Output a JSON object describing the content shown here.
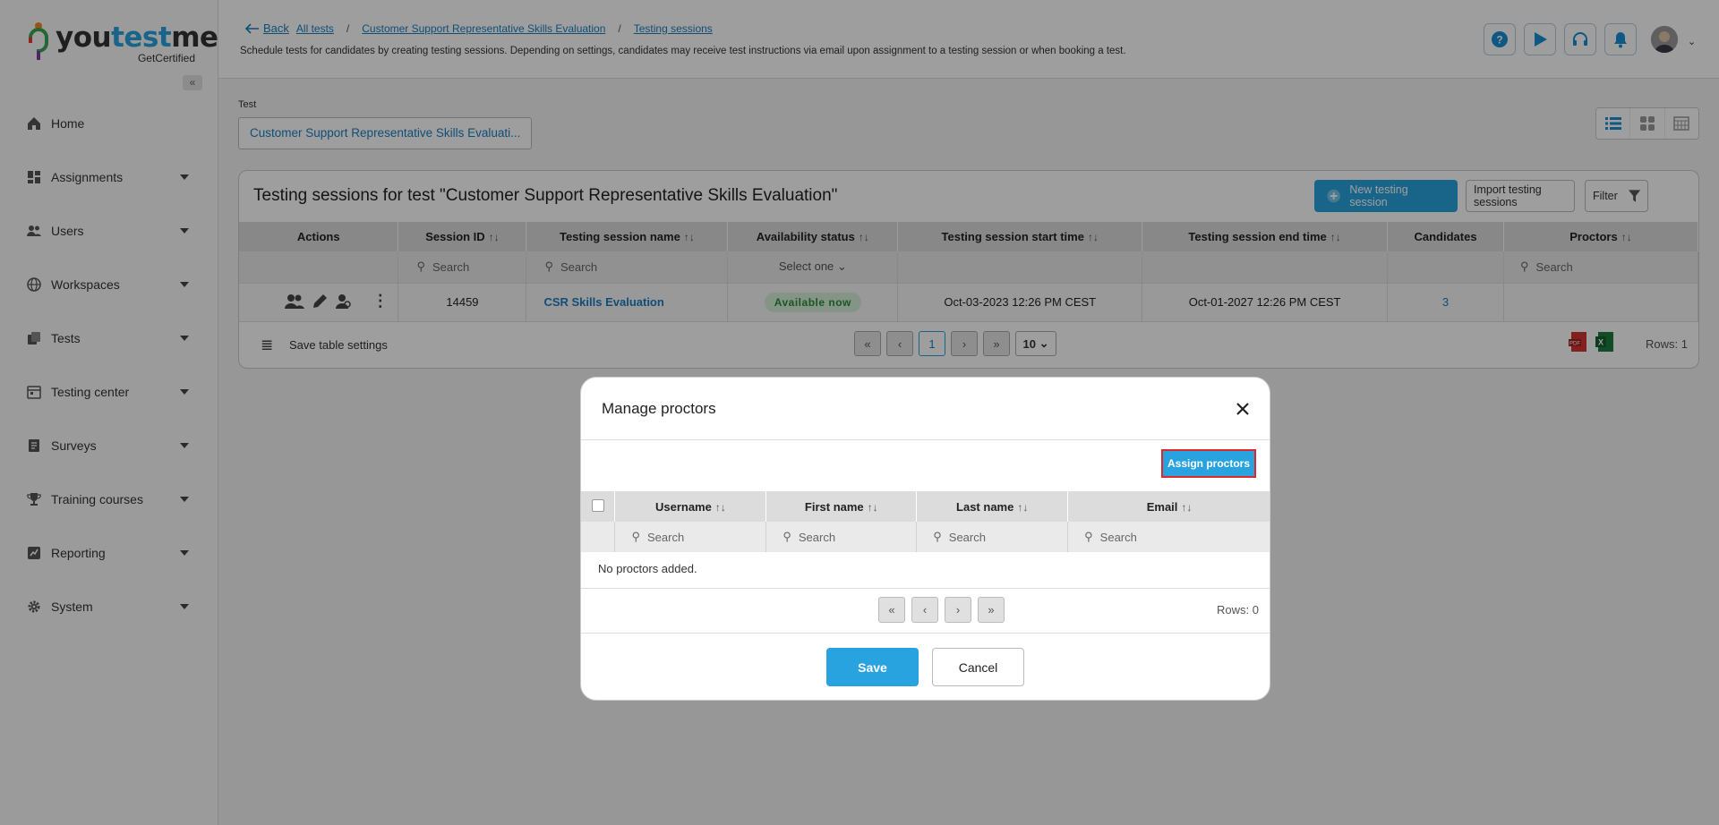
{
  "app": {
    "logo_word_a": "you",
    "logo_word_b": "test",
    "logo_word_c": "me",
    "logo_sub": "GetCertified"
  },
  "sidebar": {
    "collapse_icon": "«",
    "items": [
      {
        "label": "Home",
        "icon": "home-icon",
        "has_caret": false
      },
      {
        "label": "Assignments",
        "icon": "assignments-icon",
        "has_caret": true
      },
      {
        "label": "Users",
        "icon": "users-icon",
        "has_caret": true
      },
      {
        "label": "Workspaces",
        "icon": "globe-icon",
        "has_caret": true
      },
      {
        "label": "Tests",
        "icon": "tests-icon",
        "has_caret": true
      },
      {
        "label": "Testing center",
        "icon": "calendar-icon",
        "has_caret": true
      },
      {
        "label": "Surveys",
        "icon": "surveys-icon",
        "has_caret": true
      },
      {
        "label": "Training courses",
        "icon": "trophy-icon",
        "has_caret": true
      },
      {
        "label": "Reporting",
        "icon": "reporting-icon",
        "has_caret": true
      },
      {
        "label": "System",
        "icon": "gear-icon",
        "has_caret": true
      }
    ]
  },
  "header": {
    "back": "Back",
    "crumbs": [
      "All tests",
      "Customer Support Representative Skills Evaluation",
      "Testing sessions"
    ],
    "separator": "/",
    "description": "Schedule tests for candidates by creating testing sessions. Depending on settings, candidates may receive test instructions via email upon assignment to a testing session or when booking a test.",
    "avatar_caret": "⌄"
  },
  "test_picker": {
    "label": "Test",
    "value": "Customer Support Representative Skills Evaluati..."
  },
  "sessions": {
    "title": "Testing sessions for test \"Customer Support Representative Skills Evaluation\"",
    "new_button": "New testing session",
    "import_button": "Import testing sessions",
    "filter_button": "Filter",
    "columns": [
      "Actions",
      "Session ID",
      "Testing session name",
      "Availability status",
      "Testing session start time",
      "Testing session end time",
      "Candidates",
      "Proctors"
    ],
    "sort_glyph": "↑↓",
    "search_placeholder": "Search",
    "select_one": "Select one",
    "row": {
      "session_id": "14459",
      "name": "CSR Skills Evaluation",
      "status": "Available now",
      "start": "Oct-03-2023 12:26 PM CEST",
      "end": "Oct-01-2027 12:26 PM CEST",
      "candidates": "3",
      "proctors": ""
    },
    "save_settings": "Save table settings",
    "page": "1",
    "page_size": "10",
    "rows": "Rows: 1"
  },
  "modal": {
    "title": "Manage proctors",
    "assign_button": "Assign proctors",
    "columns": [
      "Username",
      "First name",
      "Last name",
      "Email"
    ],
    "search_placeholder": "Search",
    "empty": "No proctors added.",
    "rows": "Rows: 0",
    "save": "Save",
    "cancel": "Cancel"
  },
  "colors": {
    "accent": "#29a3df",
    "highlight_border": "#e02828",
    "status_green": "#2e8b3a"
  }
}
